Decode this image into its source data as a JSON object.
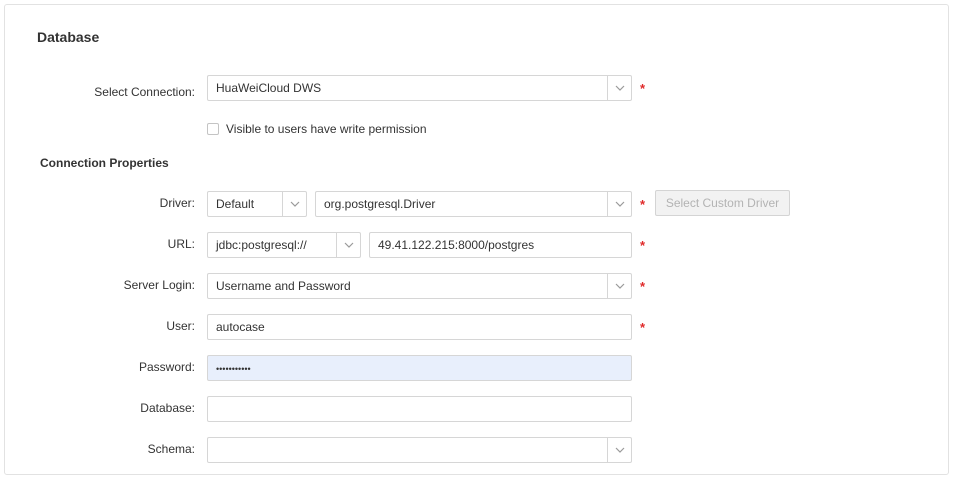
{
  "section": {
    "title": "Database"
  },
  "connection": {
    "label": "Select Connection:",
    "value": "HuaWeiCloud DWS",
    "required_mark": "*",
    "visibility_checkbox_label": "Visible to users have write permission",
    "visibility_checked": false
  },
  "properties": {
    "title": "Connection Properties",
    "driver": {
      "label": "Driver:",
      "type_value": "Default",
      "class_value": "org.postgresql.Driver",
      "required_mark": "*",
      "custom_button_label": "Select Custom Driver",
      "custom_button_enabled": false
    },
    "url": {
      "label": "URL:",
      "prefix_value": "jdbc:postgresql://",
      "address_value": "49.41.122.215:8000/postgres",
      "required_mark": "*"
    },
    "server_login": {
      "label": "Server Login:",
      "value": "Username and Password",
      "required_mark": "*"
    },
    "user": {
      "label": "User:",
      "value": "autocase",
      "required_mark": "*"
    },
    "password": {
      "label": "Password:",
      "masked_value": "•••••••••••"
    },
    "database": {
      "label": "Database:",
      "value": ""
    },
    "schema": {
      "label": "Schema:",
      "value": ""
    }
  },
  "colors": {
    "required": "#e02a2a",
    "password_bg": "#e8effc",
    "border": "#d6d6d6"
  },
  "icons": {
    "dropdown": "chevron-down-icon"
  }
}
